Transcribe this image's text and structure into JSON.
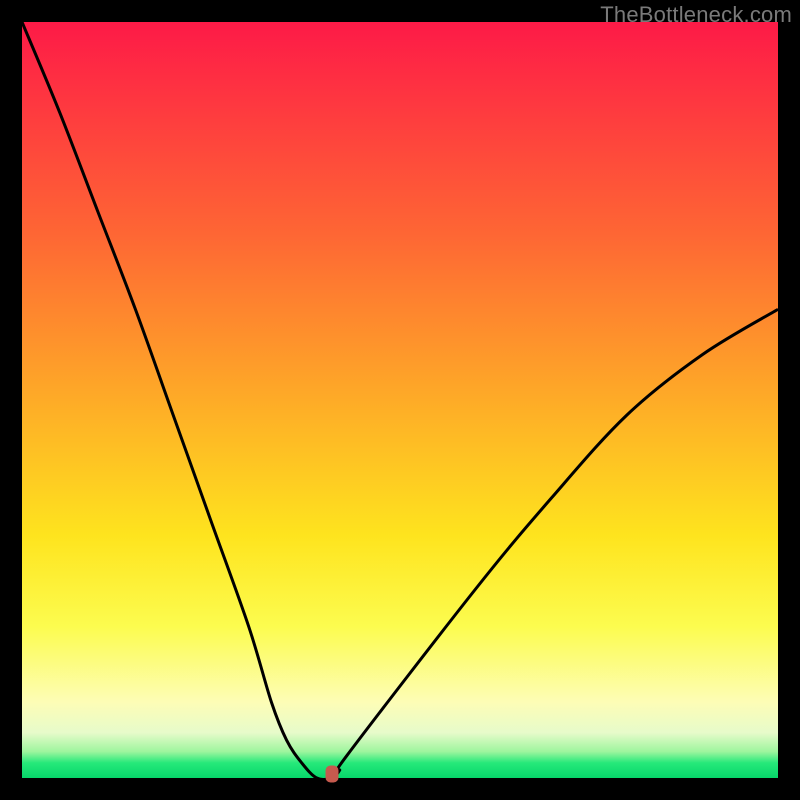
{
  "watermark": "TheBottleneck.com",
  "chart_data": {
    "type": "line",
    "title": "",
    "xlabel": "",
    "ylabel": "",
    "xlim": [
      0,
      100
    ],
    "ylim": [
      0,
      100
    ],
    "series": [
      {
        "name": "bottleneck-curve",
        "x": [
          0,
          5,
          10,
          15,
          20,
          25,
          30,
          33,
          35,
          37,
          39,
          41,
          42,
          43,
          60,
          70,
          80,
          90,
          100
        ],
        "values": [
          100,
          88,
          75,
          62,
          48,
          34,
          20,
          10,
          5,
          2,
          0,
          0,
          1,
          3,
          25,
          37,
          48,
          56,
          62
        ]
      }
    ],
    "marker": {
      "x": 41,
      "y": 0,
      "color": "#c65a4e"
    },
    "background_gradient": {
      "stops": [
        {
          "pos": 0.0,
          "color": "#fd1a47"
        },
        {
          "pos": 0.12,
          "color": "#fe3b3f"
        },
        {
          "pos": 0.28,
          "color": "#fe6634"
        },
        {
          "pos": 0.5,
          "color": "#feab27"
        },
        {
          "pos": 0.68,
          "color": "#fee41e"
        },
        {
          "pos": 0.8,
          "color": "#fcfc4f"
        },
        {
          "pos": 0.9,
          "color": "#fdfdb6"
        },
        {
          "pos": 0.94,
          "color": "#e7fbca"
        },
        {
          "pos": 0.965,
          "color": "#9ef59e"
        },
        {
          "pos": 0.98,
          "color": "#26e97a"
        },
        {
          "pos": 1.0,
          "color": "#07d66a"
        }
      ]
    }
  }
}
